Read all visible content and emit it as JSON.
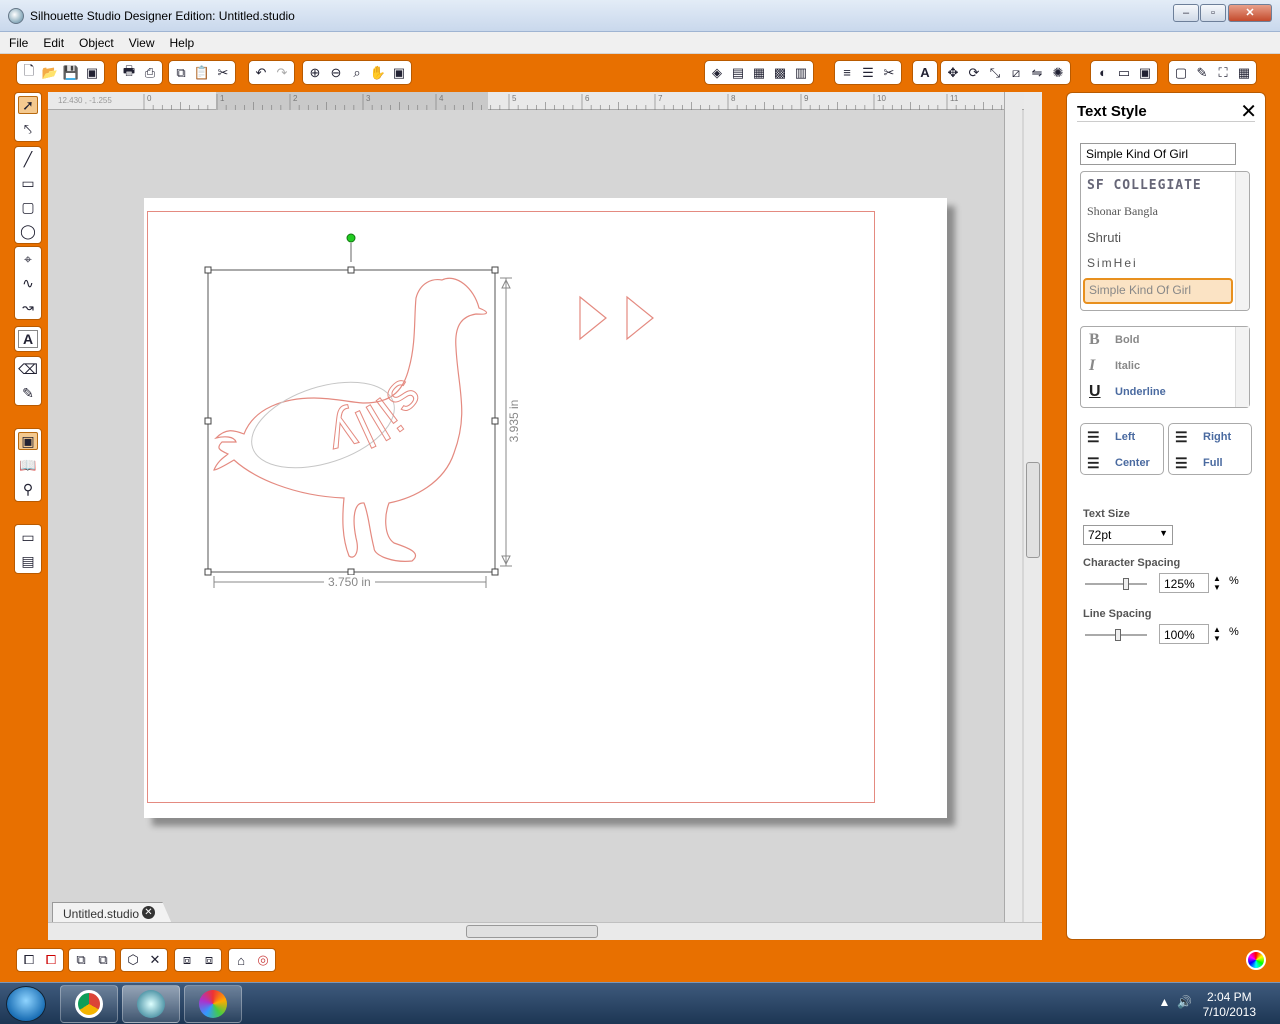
{
  "window": {
    "title": "Silhouette Studio Designer Edition: Untitled.studio"
  },
  "menu": [
    "File",
    "Edit",
    "Object",
    "View",
    "Help"
  ],
  "workspace": {
    "coord_readout": "12.430 , -1.255",
    "ruler_labels": [
      "0",
      "1",
      "2",
      "3",
      "4",
      "5",
      "6",
      "7",
      "8",
      "9",
      "10",
      "11"
    ],
    "width_dimension": "3.750 in",
    "height_dimension": "3.935 in",
    "design_text": "silly",
    "document_tab": "Untitled.studio"
  },
  "panel": {
    "title": "Text Style",
    "font_field_value": "Simple Kind Of Girl",
    "font_list": [
      "SF COLLEGIATE",
      "Shonar Bangla",
      "Shruti",
      "SimHei",
      "Simple Kind Of Girl"
    ],
    "selected_font": "Simple Kind Of Girl",
    "styles": [
      "Bold",
      "Italic",
      "Underline"
    ],
    "align_left": [
      "Left",
      "Center"
    ],
    "align_right": [
      "Right",
      "Full"
    ],
    "text_size_label": "Text Size",
    "text_size_value": "72pt",
    "char_spacing_label": "Character Spacing",
    "char_spacing_value": "125%",
    "line_spacing_label": "Line Spacing",
    "line_spacing_value": "100%",
    "percent_unit": "%"
  },
  "taskbar": {
    "time": "2:04 PM",
    "date": "7/10/2013"
  },
  "colors": {
    "accent": "#e87000",
    "cut_line": "#e48a80",
    "highlight": "#fbe3c4"
  }
}
